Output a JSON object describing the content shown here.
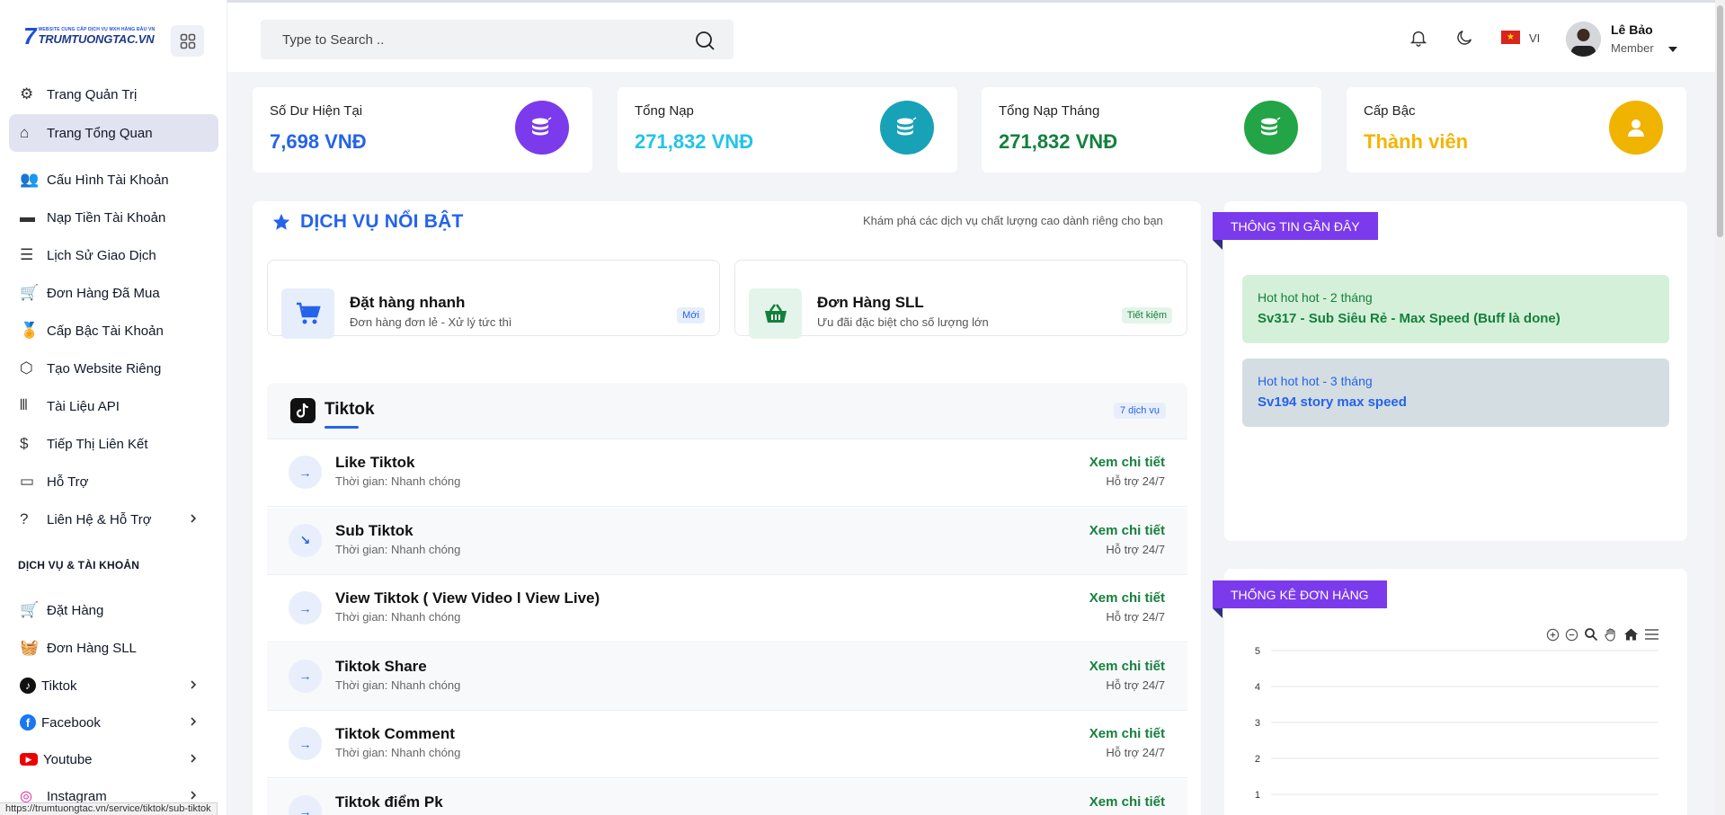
{
  "app": {
    "brand": {
      "tagline": "WEBSITE CUNG CẤP DỊCH VỤ MXH HÀNG ĐẦU VN",
      "name": "TRUMTUONGTAC.VN"
    }
  },
  "sidebar": {
    "items": [
      {
        "label": "Trang Quản Trị",
        "icon": "gears-icon"
      },
      {
        "label": "Trang Tổng Quan",
        "icon": "home-icon",
        "active": true
      },
      {
        "label": "Cấu Hình Tài Khoản",
        "icon": "users-gear-icon"
      },
      {
        "label": "Nạp Tiền Tài Khoản",
        "icon": "credit-card-icon"
      },
      {
        "label": "Lịch Sử Giao Dịch",
        "icon": "list-icon"
      },
      {
        "label": "Đơn Hàng Đã Mua",
        "icon": "cart-icon"
      },
      {
        "label": "Cấp Bậc Tài Khoản",
        "icon": "medal-icon"
      },
      {
        "label": "Tạo Website Riêng",
        "icon": "globe-icon"
      },
      {
        "label": "Tài Liệu API",
        "icon": "books-icon"
      },
      {
        "label": "Tiếp Thị Liên Kết",
        "icon": "hand-dollar-icon"
      },
      {
        "label": "Hỗ Trợ",
        "icon": "ticket-icon"
      },
      {
        "label": "Liên Hệ & Hỗ Trợ",
        "icon": "question-icon"
      }
    ],
    "section_title": "DỊCH VỤ & TÀI KHOẢN",
    "service_items": [
      {
        "label": "Đặt Hàng",
        "icon": "cart-icon"
      },
      {
        "label": "Đơn Hàng SLL",
        "icon": "basket-icon"
      },
      {
        "label": "Tiktok",
        "icon": "tiktok-icon"
      },
      {
        "label": "Facebook",
        "icon": "facebook-icon"
      },
      {
        "label": "Youtube",
        "icon": "youtube-icon"
      },
      {
        "label": "Instagram",
        "icon": "instagram-icon"
      }
    ]
  },
  "header": {
    "search_placeholder": "Type to Search ..",
    "language": "VI",
    "user": {
      "name": "Lê Bảo",
      "role": "Member"
    }
  },
  "stats": [
    {
      "label": "Số Dư Hiện Tại",
      "value": "7,698 VNĐ",
      "color": "#2563eb",
      "circle": "#7c3aed"
    },
    {
      "label": "Tổng Nạp",
      "value": "271,832 VNĐ",
      "color": "#22c4e8",
      "circle": "#17a2b8"
    },
    {
      "label": "Tổng Nạp Tháng",
      "value": "271,832 VNĐ",
      "color": "#15803d",
      "circle": "#22a447"
    },
    {
      "label": "Cấp Bậc",
      "value": "Thành viên",
      "color": "#f5b400",
      "circle": "#f0b400"
    }
  ],
  "featured": {
    "title": "DỊCH VỤ NỔI BẬT",
    "subtitle": "Khám phá các dịch vụ chất lượng cao dành riêng cho bạn",
    "quick": [
      {
        "title": "Đặt hàng nhanh",
        "sub": "Đơn hàng đơn lẻ - Xử lý tức thì",
        "badge": "Mới"
      },
      {
        "title": "Đơn Hàng SLL",
        "sub": "Ưu đãi đặc biệt cho số lượng lớn",
        "badge": "Tiết kiệm"
      }
    ],
    "platform": {
      "name": "Tiktok",
      "count": "7 dịch vụ"
    },
    "services": [
      {
        "name": "Like Tiktok",
        "time": "Thời gian: Nhanh chóng",
        "link": "Xem chi tiết",
        "support": "Hỗ trợ 24/7"
      },
      {
        "name": "Sub Tiktok",
        "time": "Thời gian: Nhanh chóng",
        "link": "Xem chi tiết",
        "support": "Hỗ trợ 24/7"
      },
      {
        "name": "View Tiktok ( View Video l View Live)",
        "time": "Thời gian: Nhanh chóng",
        "link": "Xem chi tiết",
        "support": "Hỗ trợ 24/7"
      },
      {
        "name": "Tiktok Share",
        "time": "Thời gian: Nhanh chóng",
        "link": "Xem chi tiết",
        "support": "Hỗ trợ 24/7"
      },
      {
        "name": "Tiktok Comment",
        "time": "Thời gian: Nhanh chóng",
        "link": "Xem chi tiết",
        "support": "Hỗ trợ 24/7"
      },
      {
        "name": "Tiktok điểm Pk",
        "time": "",
        "link": "Xem chi tiết",
        "support": ""
      }
    ]
  },
  "news": {
    "title": "THÔNG TIN GẦN ĐÂY",
    "items": [
      {
        "line1": "Hot hot hot - 2 tháng",
        "line2": "Sv317 - Sub Siêu Rẻ - Max Speed (Buff là done)"
      },
      {
        "line1": "Hot hot hot - 3 tháng",
        "line2": "Sv194 story max speed"
      }
    ]
  },
  "orders_chart": {
    "title": "THỐNG KÊ ĐƠN HÀNG"
  },
  "chart_data": {
    "type": "line",
    "title": "",
    "xlabel": "",
    "ylabel": "",
    "y_ticks": [
      5,
      4,
      3,
      2,
      1
    ],
    "ylim": [
      0,
      5
    ],
    "series": [],
    "grid": true
  },
  "status_url": "https://trumtuongtac.vn/service/tiktok/sub-tiktok"
}
